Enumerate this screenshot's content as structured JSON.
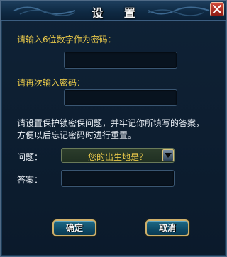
{
  "dialog": {
    "title": "设 置",
    "close_icon": "close-icon"
  },
  "form": {
    "password_label": "请输入6位数字作为密码：",
    "password_value": "",
    "confirm_label": "请再次输入密码：",
    "confirm_value": "",
    "instructions_line1": "请设置保护锁密保问题，并牢记你所填写的答案，",
    "instructions_line2": "方便以后忘记密码时进行重置。",
    "question_label": "问题：",
    "question_selected": "您的出生地是？",
    "answer_label": "答案：",
    "answer_value": ""
  },
  "buttons": {
    "confirm_label": "确定",
    "cancel_label": "取消"
  },
  "colors": {
    "label_yellow": "#e8c84a",
    "text_white": "#e9eef4",
    "background": "#0b1a2a",
    "button_border": "#d0b06a"
  }
}
